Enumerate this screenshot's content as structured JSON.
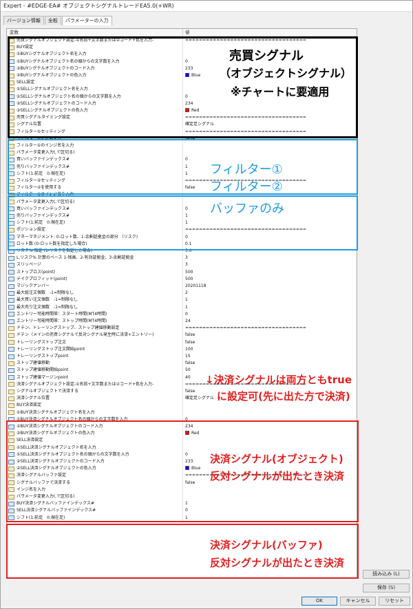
{
  "window": {
    "title": "Expert - #EDGE-EA# オブジェクトシグナルトレードEA5.0(+WR)"
  },
  "tabs": [
    {
      "label": "バージョン情報"
    },
    {
      "label": "全般"
    },
    {
      "label": "パラメーターの入力"
    }
  ],
  "grid": {
    "col_name": "変数",
    "col_value": "値"
  },
  "rows": [
    {
      "name": "売買シグナルオブジェクト設定-①名前+文字数または②コード+色を入力-",
      "value": "==================================="
    },
    {
      "name": "BUY設定",
      "value": ""
    },
    {
      "name": "①BUYシグナルオブジェクト名を入力",
      "value": ""
    },
    {
      "name": "①BUYシグナルオブジェクト名の頭からの文字数を入力",
      "value": "0"
    },
    {
      "name": "②BUYシグナルオブジェクトのコード入力",
      "value": "233"
    },
    {
      "name": "②BUYシグナルオブジェクトの色入力",
      "value": "Blue"
    },
    {
      "name": "SELL設定",
      "value": ""
    },
    {
      "name": "①SELLシグナルオブジェクト名を入力",
      "value": ""
    },
    {
      "name": "①SELLシグナルオブジェクト名の頭からの文字数を入力",
      "value": "0"
    },
    {
      "name": "②SELLシグナルオブジェクトのコード入力",
      "value": "234"
    },
    {
      "name": "②SELLシグナルオブジェクトの色入力",
      "value": "Red"
    },
    {
      "name": "売買シグナルタイミング設定",
      "value": "==================================="
    },
    {
      "name": "シグナル位置",
      "value": "確定足シグナル"
    },
    {
      "name": "フィルター①セッティング",
      "value": "==================================="
    },
    {
      "name": "フィルター①を使用する",
      "value": "false"
    },
    {
      "name": "フィルター①のインジ名を入力",
      "value": ""
    },
    {
      "name": "パラメータ変更入力(,で区切る)",
      "value": ""
    },
    {
      "name": "買いバッファインデックス#",
      "value": "0"
    },
    {
      "name": "売りバッファインデックス#",
      "value": "1"
    },
    {
      "name": "シフト(1:前足　0:現在足)",
      "value": "1"
    },
    {
      "name": "フィルター②セッティング",
      "value": "==================================="
    },
    {
      "name": "フィルター②を使用する",
      "value": "false"
    },
    {
      "name": "フィルター②のインジ名を入力",
      "value": ""
    },
    {
      "name": "パラメータ変更入力(,で区切る)",
      "value": ""
    },
    {
      "name": "買いバッファインデックス#",
      "value": "0"
    },
    {
      "name": "売りバッファインデックス#",
      "value": "1"
    },
    {
      "name": "シフト(1:前足　0:現在足)",
      "value": "1"
    },
    {
      "name": "ポジション設定",
      "value": "==================================="
    },
    {
      "name": "マネーマネジメント: 0-ロット数、1-余剰証拠金の部分 （リスク)",
      "value": "0"
    },
    {
      "name": "ロット数 (0-ロット数を指定した場合)",
      "value": "0.1"
    },
    {
      "name": "リスク% 指定 (1-リスクを指定した場合)",
      "value": "5.0"
    },
    {
      "name": "L.リスク% 計算のベース 1-残高、2-有効証拠金、3-余剰証拠金",
      "value": "3"
    },
    {
      "name": "スリッページ",
      "value": "3"
    },
    {
      "name": "ストップロス(point)",
      "value": "500"
    },
    {
      "name": "テイクプロフィット(point)",
      "value": "500"
    },
    {
      "name": "マジックナンバー",
      "value": "20201118"
    },
    {
      "name": "最大総注文個数　-1=制限なし",
      "value": "2"
    },
    {
      "name": "最大買い注文個数　-1=制限なし",
      "value": "1"
    },
    {
      "name": "最大売り注文個数　-1=制限なし",
      "value": "1"
    },
    {
      "name": "エントリー可能時間帯：スタート時間(MT4時間)",
      "value": "0"
    },
    {
      "name": "エントリー可能時間帯：ストップ時間(MT4時間)",
      "value": "24"
    },
    {
      "name": "ドテン、トレーリングストップ、ストップ建値移動設定",
      "value": "==================================="
    },
    {
      "name": "ドテン（メインの売買シグナルで反対シグナル発生時に決済+エントリー)",
      "value": "false"
    },
    {
      "name": "トレーリングストップ注文",
      "value": "false"
    },
    {
      "name": "トレーリングストップ注文開始point",
      "value": "100"
    },
    {
      "name": "トレーリングストップpoint",
      "value": "15"
    },
    {
      "name": "ストップ建値移動",
      "value": "false"
    },
    {
      "name": "ストップ建値移動開始point",
      "value": "50"
    },
    {
      "name": "ストップ建値マージンpoint",
      "value": "40"
    },
    {
      "name": "決済シグナルオブジェクト設定-①名前+文字数または②コード+色を入力-",
      "value": "==================================="
    },
    {
      "name": "シグナルオブジェクトで決済する",
      "value": "false"
    },
    {
      "name": "決済シグナル位置",
      "value": "確定足シグナル"
    },
    {
      "name": "BUY決済設定",
      "value": ""
    },
    {
      "name": "①BUY決済シグナルオブジェクト名を入力",
      "value": ""
    },
    {
      "name": "①BUY決済シグナルオブジェクト名の頭からの文字数を入力",
      "value": "0"
    },
    {
      "name": "②BUY決済シグナルオブジェクトのコード入力",
      "value": "234"
    },
    {
      "name": "②BUY決済シグナルオブジェクトの色入力",
      "value": "Red"
    },
    {
      "name": "SELL決済設定",
      "value": ""
    },
    {
      "name": "①SELL決済シグナルオブジェクト名を入力",
      "value": ""
    },
    {
      "name": "①SELL決済シグナルオブジェクト名の頭からの文字数を入力",
      "value": "0"
    },
    {
      "name": "②SELL決済シグナルオブジェクトのコード入力",
      "value": "233"
    },
    {
      "name": "②SELL決済シグナルオブジェクトの色入力",
      "value": "Blue"
    },
    {
      "name": "決済シグナルバッファ設定",
      "value": "==================================="
    },
    {
      "name": "シグナルバッファで決済する",
      "value": "false"
    },
    {
      "name": "インジ名を入力",
      "value": ""
    },
    {
      "name": "パラメータ変更入力(,で区切る)",
      "value": ""
    },
    {
      "name": "BUY決済シグナルバッファインデックス#",
      "value": "1"
    },
    {
      "name": "SELL決済シグナルバッファインデックス#",
      "value": "0"
    },
    {
      "name": "シフト(1:前足　0:現在足)",
      "value": "1"
    }
  ],
  "colors": {
    "Blue": "#0000ff",
    "Red": "#ff0000"
  },
  "overlay": {
    "buy_sell_title": "売買シグナル",
    "buy_sell_sub": "（オブジェクトシグナル）",
    "buy_sell_note": "※チャートに要適用",
    "filter1": "フィルター①",
    "filter2": "フィルター②",
    "buffer_only": "バッファのみ",
    "exit_note_1": "↓決済シグナルは両方ともtrue",
    "exit_note_2": "に設定可(先に出た方で決済)",
    "exit_obj_1": "決済シグナル(オブジェクト)",
    "exit_obj_2": "反対シグナルが出たとき決済",
    "exit_buf_1": "決済シグナル(バッファ)",
    "exit_buf_2": "反対シグナルが出たとき決済"
  },
  "buttons": {
    "load": "読み込み (L)",
    "save": "保存 (S)",
    "ok": "OK",
    "cancel": "キャンセル",
    "reset": "リセット"
  }
}
